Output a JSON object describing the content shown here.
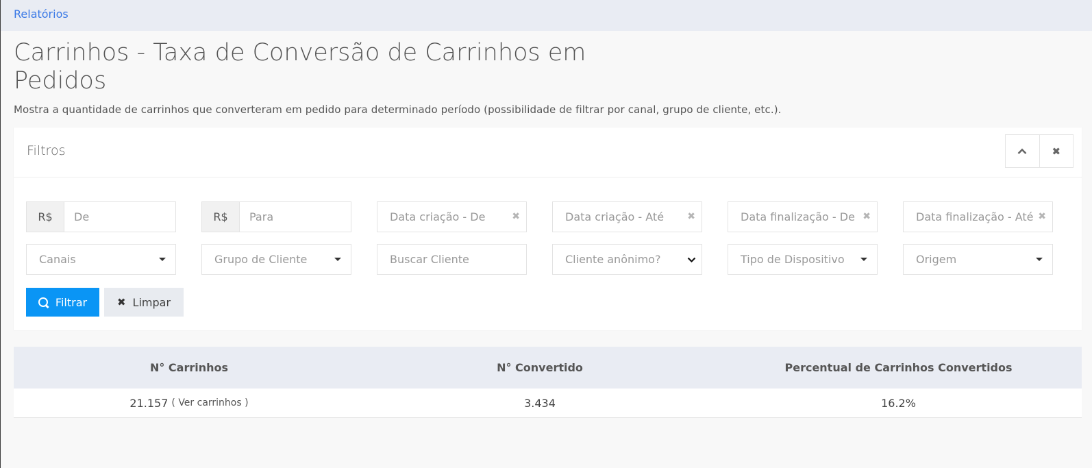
{
  "breadcrumb": "Relatórios",
  "page": {
    "title": "Carrinhos - Taxa de Conversão de Carrinhos em Pedidos",
    "description": "Mostra a quantidade de carrinhos que converteram em pedido para determinado período (possibilidade de filtrar por canal, grupo de cliente, etc.)."
  },
  "filters": {
    "title": "Filtros",
    "icons": {
      "collapse": "chevron-up-icon",
      "close": "close-icon"
    },
    "currency_symbol": "R$",
    "value_from_placeholder": "De",
    "value_to_placeholder": "Para",
    "created_from": "Data criação - De",
    "created_to": "Data criação - Até",
    "finished_from": "Data finalização - De",
    "finished_to": "Data finalização - Até",
    "channels": "Canais",
    "customer_group": "Grupo de Cliente",
    "search_customer_placeholder": "Buscar Cliente",
    "anonymous_customer": "Cliente anônimo?",
    "device_type": "Tipo de Dispositivo",
    "origin": "Origem",
    "filter_button": "Filtrar",
    "clear_button": "Limpar"
  },
  "results": {
    "headers": [
      "N° Carrinhos",
      "N° Convertido",
      "Percentual de Carrinhos Convertidos"
    ],
    "carts": "21.157",
    "view_carts_link": "( Ver carrinhos )",
    "converted": "3.434",
    "percent": "16.2%"
  }
}
